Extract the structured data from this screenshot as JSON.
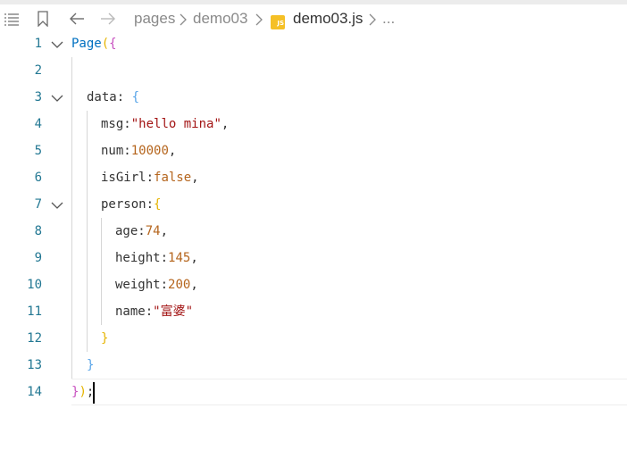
{
  "breadcrumb": {
    "items": [
      "pages",
      "demo03"
    ],
    "file_badge": "JS",
    "file_name": "demo03.js",
    "ellipsis": "..."
  },
  "icons": {
    "menu": "list-menu-icon",
    "bookmark": "bookmark-icon",
    "back": "arrow-left-icon",
    "forward": "arrow-right-icon",
    "chevron": "chevron-right-icon",
    "fold": "chevron-down-icon"
  },
  "editor": {
    "line_numbers": [
      "1",
      "2",
      "3",
      "4",
      "5",
      "6",
      "7",
      "8",
      "9",
      "10",
      "11",
      "12",
      "13",
      "14"
    ],
    "code": {
      "l1_fn": "Page",
      "l1_paren": "(",
      "l1_brace": "{",
      "l3_key": "data",
      "l3_colon": ": ",
      "l3_brace": "{",
      "l4_key": "msg",
      "l4_colon": ":",
      "l4_val": "\"hello mina\"",
      "l4_comma": ",",
      "l5_key": "num",
      "l5_colon": ":",
      "l5_val": "10000",
      "l5_comma": ",",
      "l6_key": "isGirl",
      "l6_colon": ":",
      "l6_val": "false",
      "l6_comma": ",",
      "l7_key": "person",
      "l7_colon": ":",
      "l7_brace": "{",
      "l8_key": "age",
      "l8_colon": ":",
      "l8_val": "74",
      "l8_comma": ",",
      "l9_key": "height",
      "l9_colon": ":",
      "l9_val": "145",
      "l9_comma": ",",
      "l10_key": "weight",
      "l10_colon": ":",
      "l10_val": "200",
      "l10_comma": ",",
      "l11_key": "name",
      "l11_colon": ":",
      "l11_val": "\"富婆\"",
      "l12_brace": "}",
      "l13_brace": "}",
      "l14_brace": "}",
      "l14_paren": ")",
      "l14_semi": ";"
    }
  },
  "colors": {
    "line_number": "#237893",
    "string": "#a31515",
    "number": "#b5651d",
    "js_badge": "#f5c026"
  }
}
